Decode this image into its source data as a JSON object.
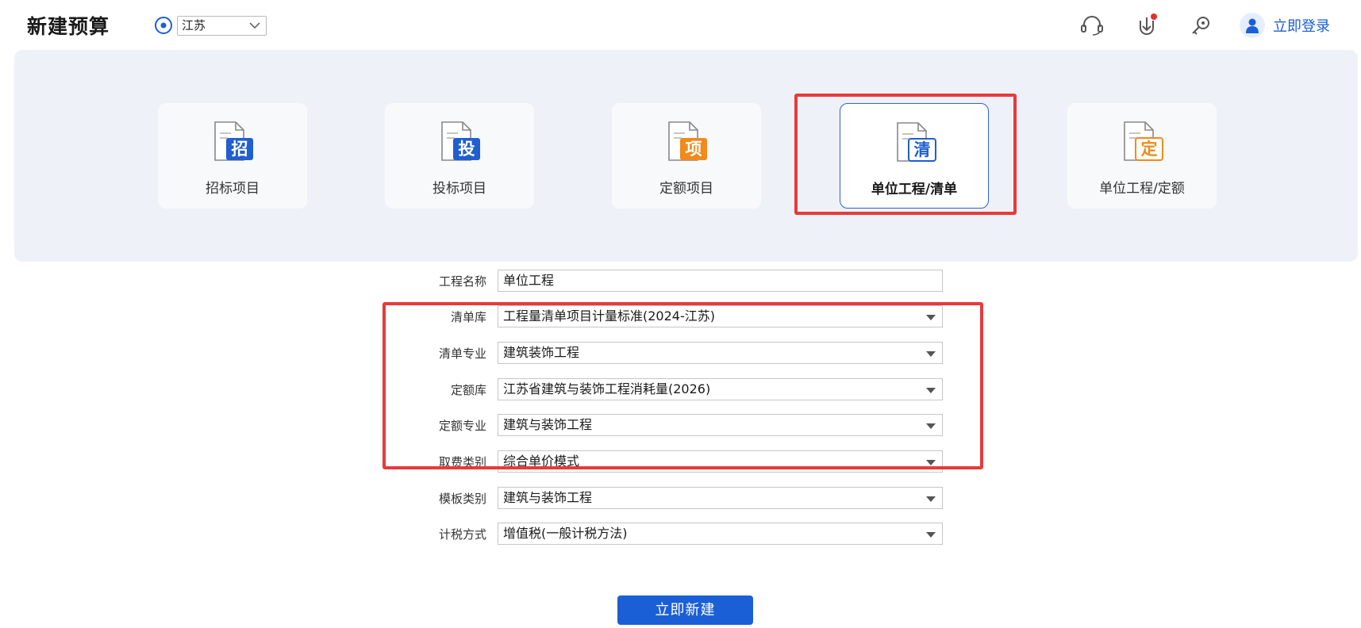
{
  "header": {
    "title": "新建预算",
    "region_value": "江苏",
    "login_label": "立即登录"
  },
  "icons": {
    "location": "location-icon",
    "support": "headset-icon",
    "download": "download-icon",
    "key": "key-icon",
    "avatar": "user-avatar-icon"
  },
  "project_types": [
    {
      "label": "招标项目",
      "badge": "招",
      "badge_color": "#1f5fcf"
    },
    {
      "label": "投标项目",
      "badge": "投",
      "badge_color": "#1f5fcf"
    },
    {
      "label": "定额项目",
      "badge": "项",
      "badge_color": "#f08a1c"
    },
    {
      "label": "单位工程/清单",
      "badge": "清",
      "badge_color": "#1f5fcf",
      "selected": true
    },
    {
      "label": "单位工程/定额",
      "badge": "定",
      "badge_color": "#f08a1c"
    }
  ],
  "form": {
    "project_name": {
      "label": "工程名称",
      "value": "单位工程"
    },
    "bill_library": {
      "label": "清单库",
      "value": "工程量清单项目计量标准(2024-江苏)"
    },
    "bill_specialty": {
      "label": "清单专业",
      "value": "建筑装饰工程"
    },
    "quota_library": {
      "label": "定额库",
      "value": "江苏省建筑与装饰工程消耗量(2026)"
    },
    "quota_specialty": {
      "label": "定额专业",
      "value": "建筑与装饰工程"
    },
    "fee_category": {
      "label": "取费类别",
      "value": "综合单价模式"
    },
    "template_category": {
      "label": "模板类别",
      "value": "建筑与装饰工程"
    },
    "tax_method": {
      "label": "计税方式",
      "value": "增值税(一般计税方法)"
    }
  },
  "actions": {
    "create_label": "立即新建"
  },
  "colors": {
    "primary": "#1a5fd6",
    "highlight": "#e83a3a",
    "panel_bg": "#eef2f8"
  }
}
